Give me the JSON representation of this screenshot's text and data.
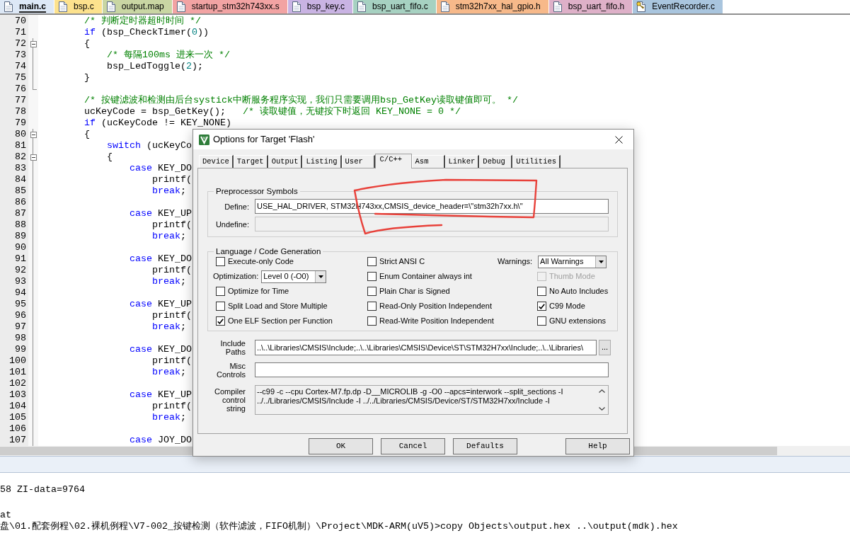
{
  "tabs": [
    {
      "label": "main.c",
      "selected": true,
      "color": "#dde8f6",
      "locked": false
    },
    {
      "label": "bsp.c",
      "selected": false,
      "color": "#fde28d",
      "locked": false
    },
    {
      "label": "output.map",
      "selected": false,
      "color": "#c9d6a3",
      "locked": false
    },
    {
      "label": "startup_stm32h743xx.s",
      "selected": false,
      "color": "#f2a3a3",
      "locked": false
    },
    {
      "label": "bsp_key.c",
      "selected": false,
      "color": "#c9b3e3",
      "locked": false
    },
    {
      "label": "bsp_uart_fifo.c",
      "selected": false,
      "color": "#a6d1c1",
      "locked": false
    },
    {
      "label": "stm32h7xx_hal_gpio.h",
      "selected": false,
      "color": "#f7b98a",
      "locked": false
    },
    {
      "label": "bsp_uart_fifo.h",
      "selected": false,
      "color": "#deb0c8",
      "locked": false
    },
    {
      "label": "EventRecorder.c",
      "selected": false,
      "color": "#a9c5de",
      "locked": true
    }
  ],
  "editor": {
    "lines": [
      {
        "number": "70",
        "fold_start": false,
        "fold_end": false,
        "code": [
          {
            "kind": "comment",
            "text": "        /* 判断定时器超时时间 */"
          }
        ]
      },
      {
        "number": "71",
        "fold_start": false,
        "fold_end": false,
        "code": [
          {
            "kind": "keyword",
            "text": "        if"
          },
          {
            "kind": "plain",
            "text": " (bsp_CheckTimer("
          },
          {
            "kind": "number",
            "text": "0"
          },
          {
            "kind": "plain",
            "text": "))"
          }
        ]
      },
      {
        "number": "72",
        "fold_start": true,
        "fold_end": false,
        "code": [
          {
            "kind": "plain",
            "text": "        {"
          }
        ]
      },
      {
        "number": "73",
        "fold_start": false,
        "fold_end": false,
        "code": [
          {
            "kind": "comment",
            "text": "            /* 每隔100ms 进来一次 */"
          }
        ]
      },
      {
        "number": "74",
        "fold_start": false,
        "fold_end": false,
        "code": [
          {
            "kind": "plain",
            "text": "            bsp_LedToggle("
          },
          {
            "kind": "number",
            "text": "2"
          },
          {
            "kind": "plain",
            "text": ");"
          }
        ]
      },
      {
        "number": "75",
        "fold_start": false,
        "fold_end": false,
        "code": [
          {
            "kind": "plain",
            "text": "        }"
          }
        ]
      },
      {
        "number": "76",
        "fold_start": false,
        "fold_end": true
      },
      {
        "number": "77",
        "fold_start": false,
        "fold_end": false,
        "code": [
          {
            "kind": "comment",
            "text": "        /* 按键滤波和检测由后台systick中断服务程序实现，我们只需要调用bsp_GetKey读取键值即可。 */"
          }
        ]
      },
      {
        "number": "78",
        "fold_start": false,
        "fold_end": false,
        "code": [
          {
            "kind": "plain",
            "text": "        ucKeyCode = bsp_GetKey();   "
          },
          {
            "kind": "comment",
            "text": "/* 读取键值，无键按下时返回 KEY_NONE = 0 */"
          }
        ]
      },
      {
        "number": "79",
        "fold_start": false,
        "fold_end": false,
        "code": [
          {
            "kind": "keyword",
            "text": "        if"
          },
          {
            "kind": "plain",
            "text": " (ucKeyCode != KEY_NONE)"
          }
        ]
      },
      {
        "number": "80",
        "fold_start": true,
        "fold_end": false,
        "code": [
          {
            "kind": "plain",
            "text": "        {"
          }
        ]
      },
      {
        "number": "81",
        "fold_start": false,
        "fold_end": false,
        "code": [
          {
            "kind": "keyword",
            "text": "            switch"
          },
          {
            "kind": "plain",
            "text": " (ucKeyCo"
          }
        ]
      },
      {
        "number": "82",
        "fold_start": true,
        "fold_end": false,
        "code": [
          {
            "kind": "plain",
            "text": "            {"
          }
        ]
      },
      {
        "number": "83",
        "fold_start": false,
        "fold_end": false,
        "code": [
          {
            "kind": "keyword",
            "text": "                case"
          },
          {
            "kind": "plain",
            "text": " KEY_DO"
          }
        ]
      },
      {
        "number": "84",
        "fold_start": false,
        "fold_end": false,
        "code": [
          {
            "kind": "plain",
            "text": "                    printf("
          }
        ]
      },
      {
        "number": "85",
        "fold_start": false,
        "fold_end": false,
        "code": [
          {
            "kind": "keyword",
            "text": "                    break"
          },
          {
            "kind": "plain",
            "text": ";"
          }
        ]
      },
      {
        "number": "86",
        "fold_start": false,
        "fold_end": false
      },
      {
        "number": "87",
        "fold_start": false,
        "fold_end": false,
        "code": [
          {
            "kind": "keyword",
            "text": "                case"
          },
          {
            "kind": "plain",
            "text": " KEY_UP"
          }
        ]
      },
      {
        "number": "88",
        "fold_start": false,
        "fold_end": false,
        "code": [
          {
            "kind": "plain",
            "text": "                    printf("
          }
        ]
      },
      {
        "number": "89",
        "fold_start": false,
        "fold_end": false,
        "code": [
          {
            "kind": "keyword",
            "text": "                    break"
          },
          {
            "kind": "plain",
            "text": ";"
          }
        ]
      },
      {
        "number": "90",
        "fold_start": false,
        "fold_end": false
      },
      {
        "number": "91",
        "fold_start": false,
        "fold_end": false,
        "code": [
          {
            "kind": "keyword",
            "text": "                case"
          },
          {
            "kind": "plain",
            "text": " KEY_DO"
          }
        ]
      },
      {
        "number": "92",
        "fold_start": false,
        "fold_end": false,
        "code": [
          {
            "kind": "plain",
            "text": "                    printf("
          }
        ]
      },
      {
        "number": "93",
        "fold_start": false,
        "fold_end": false,
        "code": [
          {
            "kind": "keyword",
            "text": "                    break"
          },
          {
            "kind": "plain",
            "text": ";"
          }
        ]
      },
      {
        "number": "94",
        "fold_start": false,
        "fold_end": false
      },
      {
        "number": "95",
        "fold_start": false,
        "fold_end": false,
        "code": [
          {
            "kind": "keyword",
            "text": "                case"
          },
          {
            "kind": "plain",
            "text": " KEY_UP"
          }
        ]
      },
      {
        "number": "96",
        "fold_start": false,
        "fold_end": false,
        "code": [
          {
            "kind": "plain",
            "text": "                    printf("
          }
        ]
      },
      {
        "number": "97",
        "fold_start": false,
        "fold_end": false,
        "code": [
          {
            "kind": "keyword",
            "text": "                    break"
          },
          {
            "kind": "plain",
            "text": ";"
          }
        ]
      },
      {
        "number": "98",
        "fold_start": false,
        "fold_end": false
      },
      {
        "number": "99",
        "fold_start": false,
        "fold_end": false,
        "code": [
          {
            "kind": "keyword",
            "text": "                case"
          },
          {
            "kind": "plain",
            "text": " KEY_DO"
          }
        ]
      },
      {
        "number": "100",
        "fold_start": false,
        "fold_end": false,
        "code": [
          {
            "kind": "plain",
            "text": "                    printf("
          }
        ]
      },
      {
        "number": "101",
        "fold_start": false,
        "fold_end": false,
        "code": [
          {
            "kind": "keyword",
            "text": "                    break"
          },
          {
            "kind": "plain",
            "text": ";"
          }
        ]
      },
      {
        "number": "102",
        "fold_start": false,
        "fold_end": false
      },
      {
        "number": "103",
        "fold_start": false,
        "fold_end": false,
        "code": [
          {
            "kind": "keyword",
            "text": "                case"
          },
          {
            "kind": "plain",
            "text": " KEY_UP"
          }
        ]
      },
      {
        "number": "104",
        "fold_start": false,
        "fold_end": false,
        "code": [
          {
            "kind": "plain",
            "text": "                    printf("
          }
        ]
      },
      {
        "number": "105",
        "fold_start": false,
        "fold_end": false,
        "code": [
          {
            "kind": "keyword",
            "text": "                    break"
          },
          {
            "kind": "plain",
            "text": ";"
          }
        ]
      },
      {
        "number": "106",
        "fold_start": false,
        "fold_end": false
      },
      {
        "number": "107",
        "fold_start": false,
        "fold_end": false,
        "code": [
          {
            "kind": "keyword",
            "text": "                case"
          },
          {
            "kind": "plain",
            "text": " JOY_DO"
          }
        ]
      }
    ]
  },
  "dialog": {
    "title": "Options for Target 'Flash'",
    "tabs": [
      {
        "label": "Device",
        "selected": false
      },
      {
        "label": "Target",
        "selected": false
      },
      {
        "label": "Output",
        "selected": false
      },
      {
        "label": "Listing",
        "selected": false
      },
      {
        "label": "User",
        "selected": false
      },
      {
        "label": "C/C++",
        "selected": true
      },
      {
        "label": "Asm",
        "selected": false
      },
      {
        "label": "Linker",
        "selected": false
      },
      {
        "label": "Debug",
        "selected": false
      },
      {
        "label": "Utilities",
        "selected": false
      }
    ],
    "preprocessor": {
      "title": "Preprocessor Symbols",
      "fields": [
        {
          "label": "Define:",
          "value": "USE_HAL_DRIVER, STM32H743xx,CMSIS_device_header=\\\"stm32h7xx.h\\\"",
          "disabled": false
        },
        {
          "label": "Undefine:",
          "disabled": true
        }
      ]
    },
    "language": {
      "title": "Language / Code Generation",
      "columns": [
        [
          {
            "kind": "checkbox",
            "label": "Execute-only Code",
            "checked": false,
            "disabled": false
          },
          {
            "kind": "select",
            "label": "Optimization:",
            "value": "Level 0 (-O0)"
          },
          {
            "kind": "checkbox",
            "label": "Optimize for Time",
            "checked": false,
            "disabled": false
          },
          {
            "kind": "checkbox",
            "label": "Split Load and Store Multiple",
            "checked": false,
            "disabled": false
          },
          {
            "kind": "checkbox",
            "label": "One ELF Section per Function",
            "checked": true,
            "disabled": false
          }
        ],
        [
          {
            "kind": "checkbox",
            "label": "Strict ANSI C",
            "checked": false,
            "disabled": false
          },
          {
            "kind": "checkbox",
            "label": "Enum Container always int",
            "checked": false,
            "disabled": false
          },
          {
            "kind": "checkbox",
            "label": "Plain Char is Signed",
            "checked": false,
            "disabled": false
          },
          {
            "kind": "checkbox",
            "label": "Read-Only Position Independent",
            "checked": false,
            "disabled": false
          },
          {
            "kind": "checkbox",
            "label": "Read-Write Position Independent",
            "checked": false,
            "disabled": false
          }
        ],
        [
          {
            "kind": "select",
            "label": "Warnings:",
            "value": "All Warnings"
          },
          {
            "kind": "checkbox",
            "label": "Thumb Mode",
            "checked": false,
            "disabled": true
          },
          {
            "kind": "checkbox",
            "label": "No Auto Includes",
            "checked": false,
            "disabled": false
          },
          {
            "kind": "checkbox",
            "label": "C99 Mode",
            "checked": true,
            "disabled": false
          },
          {
            "kind": "checkbox",
            "label": "GNU extensions",
            "checked": false,
            "disabled": false
          }
        ]
      ]
    },
    "include_paths": {
      "label": "Include Paths",
      "value": "..\\..\\Libraries\\CMSIS\\Include;..\\..\\Libraries\\CMSIS\\Device\\ST\\STM32H7xx\\Include;..\\..\\Libraries\\",
      "button": "..."
    },
    "misc_controls": {
      "label": "Misc Controls"
    },
    "compiler_string": {
      "label": "Compiler control string",
      "lines": [
        "--c99 -c --cpu Cortex-M7.fp.dp -D__MICROLIB -g -O0 --apcs=interwork --split_sections -I",
        "../../Libraries/CMSIS/Include -I ../../Libraries/CMSIS/Device/ST/STM32H7xx/Include -I"
      ]
    },
    "buttons": [
      "OK",
      "Cancel",
      "Defaults"
    ],
    "help_button": "Help"
  },
  "output": {
    "lines": [
      "58 ZI-data=9764",
      "at",
      "盘\\01.配套例程\\02.裸机例程\\V7-002_按键检测（软件滤波，FIFO机制）\\Project\\MDK-ARM(uV5)>copy Objects\\output.hex ..\\output(mdk).hex"
    ]
  }
}
